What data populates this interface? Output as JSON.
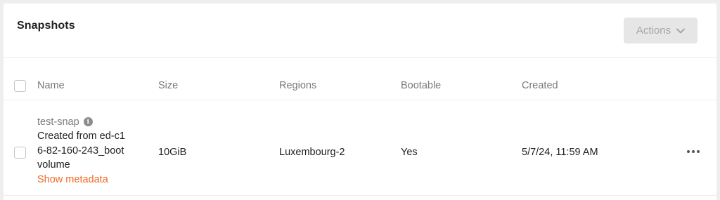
{
  "panel": {
    "title": "Snapshots",
    "actions_label": "Actions"
  },
  "table": {
    "columns": [
      "Name",
      "Size",
      "Regions",
      "Bootable",
      "Created"
    ],
    "rows": [
      {
        "name": "test-snap",
        "description": "Created from ed-c16-82-160-243_bootvolume",
        "show_metadata_label": "Show metadata",
        "size": "10GiB",
        "region": "Luxembourg-2",
        "bootable": "Yes",
        "created": "5/7/24, 11:59 AM"
      }
    ]
  },
  "colors": {
    "accent": "#f06a23",
    "button_bg": "#e6e6e6",
    "button_text": "#a6a6a6"
  },
  "icons": {
    "info": "info-icon",
    "row_menu": "more-horizontal-icon",
    "dropdown": "chevron-down-icon"
  }
}
